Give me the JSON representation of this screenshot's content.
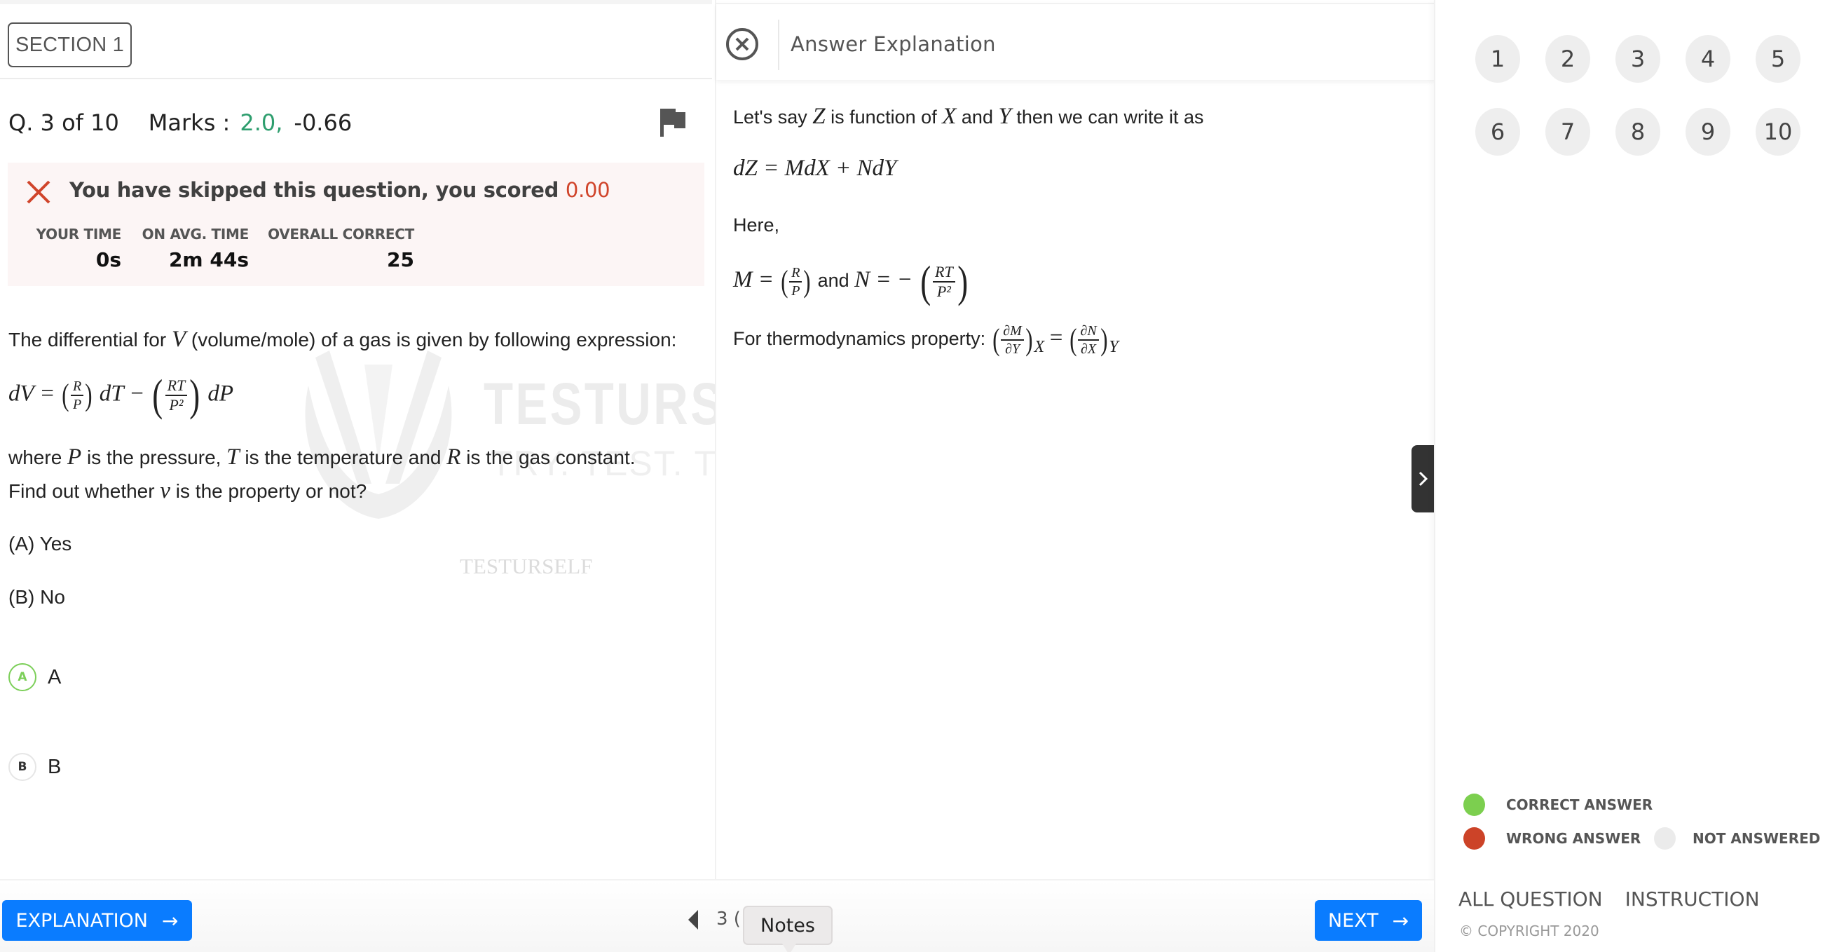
{
  "section": {
    "label": "SECTION 1"
  },
  "question_meta": {
    "number_text": "Q. 3 of 10",
    "marks_label": "Marks :",
    "marks_positive": "2.0,",
    "marks_negative": "-0.66"
  },
  "result": {
    "message": "You have skipped this question, you scored",
    "score": "0.00",
    "stats": [
      {
        "label": "YOUR TIME",
        "value": "0s"
      },
      {
        "label": "ON AVG. TIME",
        "value": "2m 44s"
      },
      {
        "label": "OVERALL CORRECT",
        "value": "25"
      }
    ]
  },
  "question": {
    "intro_pre": "The differential for",
    "intro_var": "V",
    "intro_post": "(volume/mole) of a gas is given by following expression:",
    "equation": {
      "lhs": "dV =",
      "t1_num": "R",
      "t1_den": "P",
      "t1_after": "dT −",
      "t2_num": "RT",
      "t2_den": "P²",
      "t2_after": "dP"
    },
    "where_parts": [
      "where",
      "P",
      "is the pressure,",
      "T",
      "is the temperature and",
      "R",
      "is the gas constant."
    ],
    "find_parts": [
      "Find out whether",
      "v",
      "is the property or not?"
    ],
    "option_a": "(A) Yes",
    "option_b": "(B) No"
  },
  "choices": [
    {
      "letter": "A",
      "label": "A",
      "status": "correct"
    },
    {
      "letter": "B",
      "label": "B",
      "status": "none"
    }
  ],
  "watermark": {
    "brand": "TESTURSE",
    "tagline": "TRY. TEST. TRIUM",
    "small": "TESTURSELF"
  },
  "explanation": {
    "title": "Answer Explanation",
    "line1_parts": [
      "Let's say",
      "Z",
      "is function of",
      "X",
      "and",
      "Y",
      "then we can write it as"
    ],
    "line2": "dZ = MdX + NdY",
    "line3": "Here,",
    "line4": {
      "m_lhs": "M =",
      "m_num": "R",
      "m_den": "P",
      "and": "and",
      "n_lhs": "N = −",
      "n_num": "RT",
      "n_den": "P²"
    },
    "line5": {
      "label": "For thermodynamics property:",
      "l_num": "∂M",
      "l_den": "∂Y",
      "l_sub": "X",
      "eq": "=",
      "r_num": "∂N",
      "r_den": "∂X",
      "r_sub": "Y"
    }
  },
  "navigation": {
    "question_numbers": [
      "1",
      "2",
      "3",
      "4",
      "5",
      "6",
      "7",
      "8",
      "9",
      "10"
    ],
    "legend": [
      {
        "label": "CORRECT ANSWER",
        "color": "#7ccf4f"
      },
      {
        "label": "WRONG ANSWER",
        "color": "#cc4328"
      },
      {
        "label": "NOT ANSWERED",
        "color": "#ebebeb"
      }
    ],
    "links": [
      "ALL QUESTION",
      "INSTRUCTION"
    ],
    "copyright": "© COPYRIGHT 2020"
  },
  "footer": {
    "explanation_label": "EXPLANATION",
    "next_label": "NEXT",
    "page_indicator": "3 (",
    "notes_tooltip": "Notes"
  },
  "colors": {
    "primary": "#0a7cff",
    "correct": "#7ccf4f",
    "wrong": "#cc4328",
    "positive_marks": "#2e9e6e",
    "score_red": "#d0442a"
  }
}
